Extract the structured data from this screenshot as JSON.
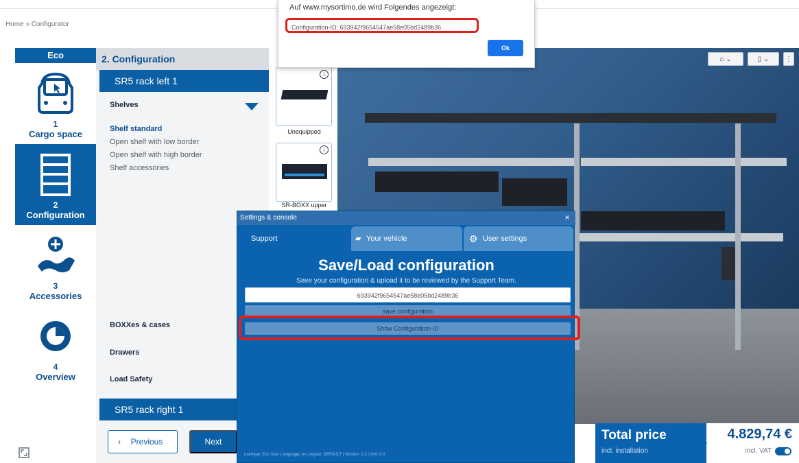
{
  "breadcrumb": "Home » Configurator",
  "sidebar": {
    "header": "Eco",
    "steps": [
      {
        "num": "1",
        "label": "Cargo space",
        "icon": "van-icon"
      },
      {
        "num": "2",
        "label": "Configuration",
        "icon": "shelving-icon"
      },
      {
        "num": "3",
        "label": "Accessories",
        "icon": "accessories-icon"
      },
      {
        "num": "4",
        "label": "Overview",
        "icon": "eye-icon"
      }
    ]
  },
  "config": {
    "heading": "2. Configuration",
    "rack_left": "SR5 rack left 1",
    "shelves_label": "Shelves",
    "shelf_options": [
      "Shelf standard",
      "Open shelf with low border",
      "Open shelf with high border",
      "Shelf accessories"
    ],
    "boxxes": "BOXXes & cases",
    "drawers": "Drawers",
    "load_safety": "Load Safety",
    "rack_right": "SR5 rack right 1",
    "prev_label": "Previous",
    "next_label": "Next"
  },
  "thumbs": [
    {
      "caption": "Unequipped"
    },
    {
      "caption": "SR-BOXX upper"
    }
  ],
  "alert": {
    "title": "Auf www.mysortimo.de wird Folgendes angezeigt:",
    "message": "Configuration-ID: 693942f9654547ae58e05bd2489b36",
    "ok": "Ok"
  },
  "dialog": {
    "title": "Settings & console",
    "tabs": [
      "Support",
      "Your vehicle",
      "User settings"
    ],
    "heading": "Save/Load configuration",
    "subtitle": "Save your configuration & upload it to be reviewed by the Support Team.",
    "config_id": "693942f9654547ae58e05bd2489b36",
    "save_btn": "save configuration",
    "show_btn": "Show Configuration-ID",
    "footer": "usertype: Eco User | language: en | region: DEFAULT | Version: 1.3 | Xml: 0.0"
  },
  "price": {
    "title": "Total price",
    "subtitle": "incl. installation",
    "value": "4.829,74 €",
    "vat": "incl. VAT"
  },
  "colors": {
    "brand_blue": "#0b5fa5",
    "highlight_red": "#e0201b"
  }
}
